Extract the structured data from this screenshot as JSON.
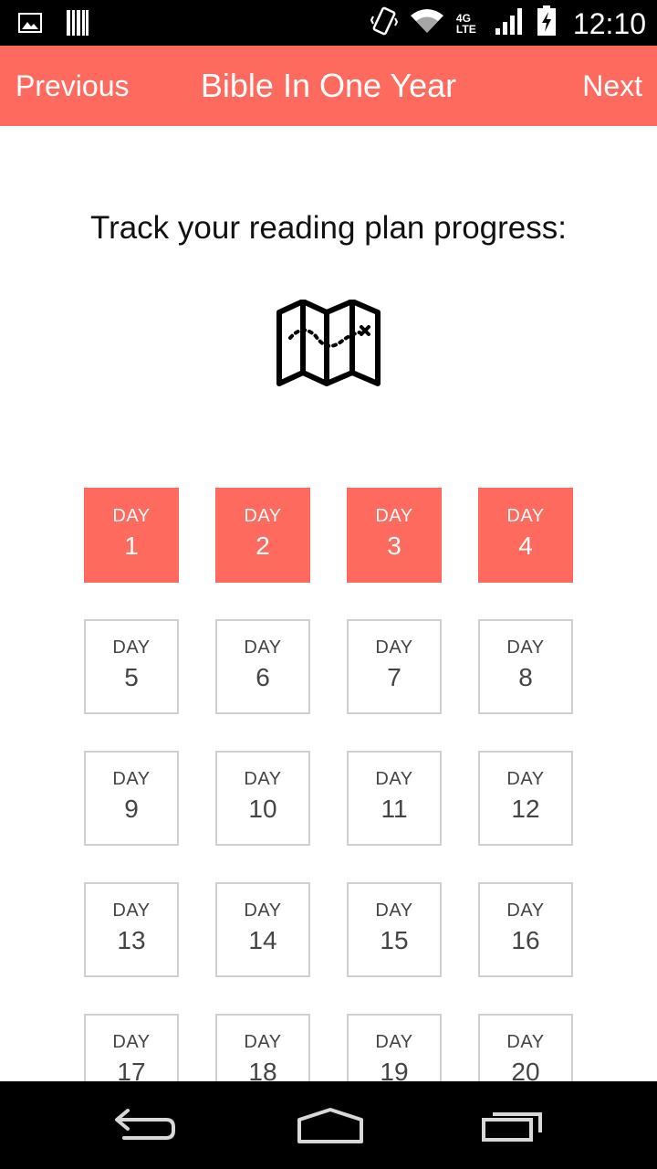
{
  "status_bar": {
    "time": "12:10",
    "network": "4G LTE"
  },
  "app_bar": {
    "previous_label": "Previous",
    "title": "Bible In One Year",
    "next_label": "Next"
  },
  "content": {
    "headline": "Track your reading plan progress:"
  },
  "days": {
    "label": "DAY",
    "items": [
      {
        "number": "1",
        "completed": true
      },
      {
        "number": "2",
        "completed": true
      },
      {
        "number": "3",
        "completed": true
      },
      {
        "number": "4",
        "completed": true
      },
      {
        "number": "5",
        "completed": false
      },
      {
        "number": "6",
        "completed": false
      },
      {
        "number": "7",
        "completed": false
      },
      {
        "number": "8",
        "completed": false
      },
      {
        "number": "9",
        "completed": false
      },
      {
        "number": "10",
        "completed": false
      },
      {
        "number": "11",
        "completed": false
      },
      {
        "number": "12",
        "completed": false
      },
      {
        "number": "13",
        "completed": false
      },
      {
        "number": "14",
        "completed": false
      },
      {
        "number": "15",
        "completed": false
      },
      {
        "number": "16",
        "completed": false
      },
      {
        "number": "17",
        "completed": false
      },
      {
        "number": "18",
        "completed": false
      },
      {
        "number": "19",
        "completed": false
      },
      {
        "number": "20",
        "completed": false
      }
    ]
  },
  "colors": {
    "accent": "#ff6a5e",
    "tile_border": "#d0d0d0"
  },
  "icons": {
    "status_left": [
      "image-icon",
      "barcode-icon"
    ],
    "status_right": [
      "vibrate-icon",
      "wifi-icon",
      "signal-icon",
      "battery-icon"
    ],
    "content": "map-icon",
    "nav": [
      "back-icon",
      "home-icon",
      "recent-apps-icon"
    ]
  }
}
